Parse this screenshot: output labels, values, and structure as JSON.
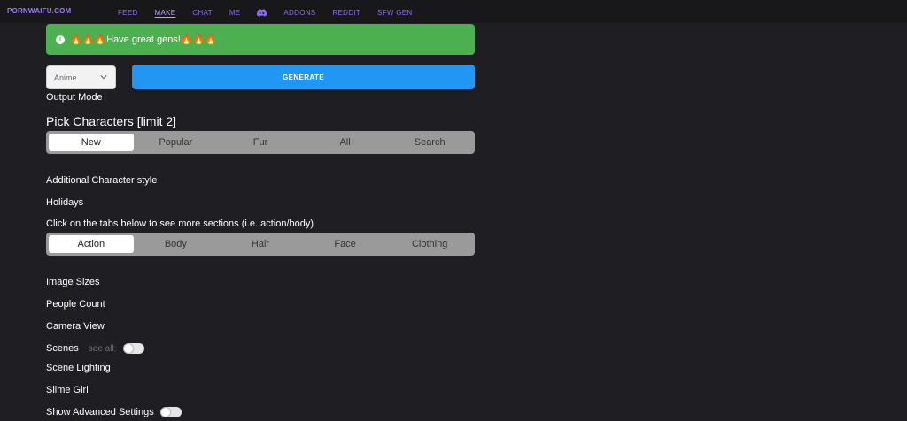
{
  "nav": {
    "brand": "PORNWAIFU.COM",
    "links": [
      {
        "label": "FEED"
      },
      {
        "label": "MAKE"
      },
      {
        "label": "CHAT"
      },
      {
        "label": "ME"
      },
      {
        "label": "ADDONS"
      },
      {
        "label": "REDDIT"
      },
      {
        "label": "SFW GEN"
      }
    ],
    "active": "MAKE",
    "discord_icon": "discord-icon"
  },
  "banner": {
    "text": "🔥🔥🔥Have great gens!🔥🔥🔥",
    "icon": "info-icon",
    "color": "#4caf50"
  },
  "controls": {
    "output_mode_value": "Anime",
    "generate_label": "GENERATE",
    "generate_color": "#2196f3"
  },
  "labels": {
    "output_mode": "Output Mode",
    "pick_characters": "Pick Characters [limit 2]",
    "additional_style": "Additional Character style",
    "holidays": "Holidays",
    "tabs_hint": "Click on the tabs below to see more sections (i.e. action/body)",
    "image_sizes": "Image Sizes",
    "people_count": "People Count",
    "camera_view": "Camera View",
    "scenes": "Scenes",
    "see_all": "see all:",
    "scene_lighting": "Scene Lighting",
    "slime_girl": "Slime Girl",
    "show_advanced": "Show Advanced Settings"
  },
  "character_tabs": {
    "items": [
      "New",
      "Popular",
      "Fur",
      "All",
      "Search"
    ],
    "active": "New"
  },
  "section_tabs": {
    "items": [
      "Action",
      "Body",
      "Hair",
      "Face",
      "Clothing"
    ],
    "active": "Action"
  },
  "toggles": {
    "scenes_see_all": false,
    "show_advanced": false
  }
}
